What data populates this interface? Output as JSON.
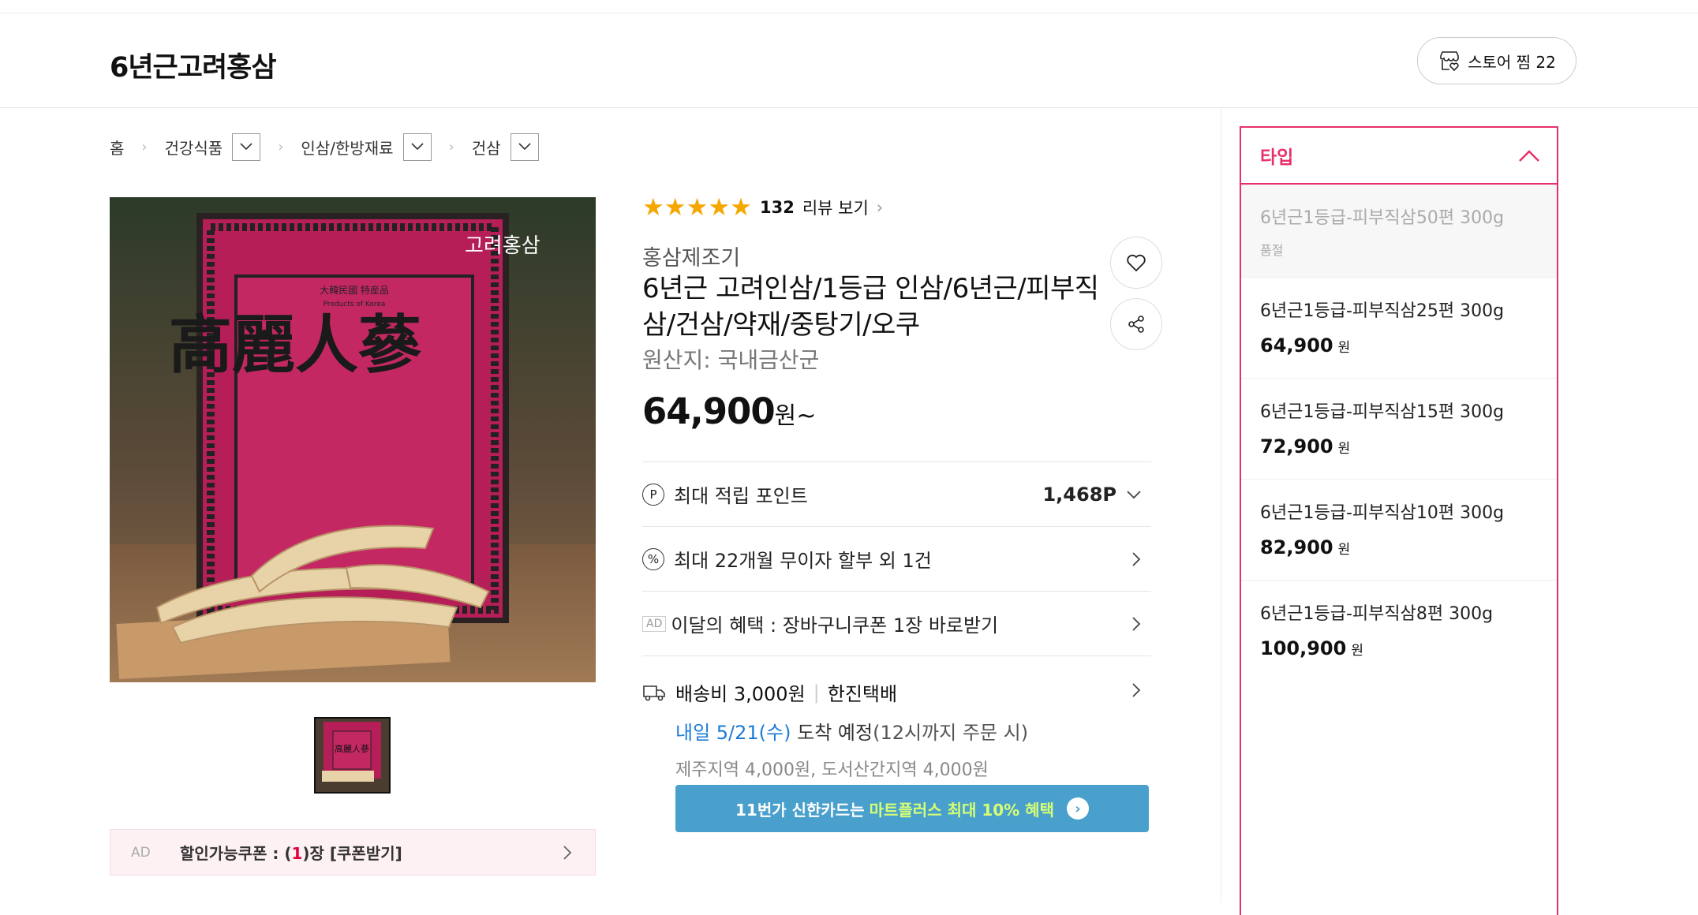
{
  "store": {
    "name": "6년근고려홍삼",
    "like_label": "스토어 찜 22"
  },
  "breadcrumb": {
    "home": "홈",
    "items": [
      {
        "label": "건강식품"
      },
      {
        "label": "인삼/한방재료"
      },
      {
        "label": "건삼"
      }
    ]
  },
  "coupon": {
    "ad": "AD",
    "prefix": "할인가능쿠폰 : (",
    "count": "1",
    "suffix": ")장 [쿠폰받기]"
  },
  "product": {
    "stars": "★★★★★",
    "review_count": "132",
    "review_label": "리뷰 보기",
    "seller": "홍삼제조기",
    "title": "6년근 고려인삼/1등급 인삼/6년근/피부직삼/건삼/약재/중탕기/오쿠",
    "origin": "원산지:  국내금산군",
    "price": "64,900",
    "price_unit": "원~",
    "image_text": "高麗人蔘",
    "image_badge": "고려홍삼"
  },
  "benefits": {
    "points_label": "최대 적립 포인트",
    "points_value": "1,468P",
    "installment_label": "최대 22개월 무이자 할부 외 1건",
    "ad_tag": "AD",
    "coupon_label": "이달의 혜택 : 장바구니쿠폰 1장 바로받기"
  },
  "shipping": {
    "fee": "배송비 3,000원",
    "courier": "한진택배",
    "arrival_day": "내일 5/21(수)",
    "arrival_text": " 도착 예정",
    "arrival_note": "(12시까지 주문 시)",
    "extra": "제주지역 4,000원, 도서산간지역 4,000원"
  },
  "banner": {
    "prefix": "11번가 신한카드는 ",
    "highlight": "마트플러스 최대 10% 혜택",
    "go": "›"
  },
  "options": {
    "header": "타입",
    "items": [
      {
        "name": "6년근1등급-피부직삼50편 300g",
        "status": "품절"
      },
      {
        "name": "6년근1등급-피부직삼25편 300g",
        "price": "64,900",
        "unit": "원"
      },
      {
        "name": "6년근1등급-피부직삼15편 300g",
        "price": "72,900",
        "unit": "원"
      },
      {
        "name": "6년근1등급-피부직삼10편 300g",
        "price": "82,900",
        "unit": "원"
      },
      {
        "name": "6년근1등급-피부직삼8편 300g",
        "price": "100,900",
        "unit": "원"
      }
    ]
  },
  "colors": {
    "accent": "#e8306a",
    "star": "#f5a700",
    "link_blue": "#1b7bd8",
    "banner": "#4aa0cc"
  }
}
